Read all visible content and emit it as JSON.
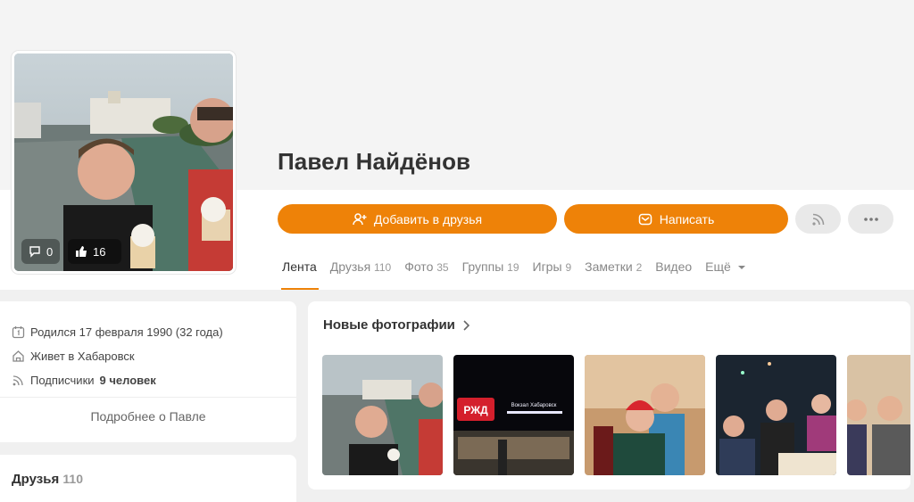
{
  "profile": {
    "name": "Павел Найдёнов",
    "comments_count": "0",
    "likes_count": "16"
  },
  "actions": {
    "add_friend_label": "Добавить в друзья",
    "write_label": "Написать",
    "subscribe_icon": "rss-icon",
    "more_icon": "ellipsis-icon"
  },
  "tabs": [
    {
      "label": "Лента",
      "count": ""
    },
    {
      "label": "Друзья",
      "count": "110"
    },
    {
      "label": "Фото",
      "count": "35"
    },
    {
      "label": "Группы",
      "count": "19"
    },
    {
      "label": "Игры",
      "count": "9"
    },
    {
      "label": "Заметки",
      "count": "2"
    },
    {
      "label": "Видео",
      "count": ""
    },
    {
      "label": "Ещё",
      "count": ""
    }
  ],
  "info": {
    "birth": "Родился 17 февраля 1990 (32 года)",
    "city": "Живет в Хабаровск",
    "subscribers_prefix": "Подписчики",
    "subscribers_value": "9 человек",
    "more_link": "Подробнее о Павле"
  },
  "friends": {
    "title": "Друзья",
    "count": "110"
  },
  "photos": {
    "title": "Новые фотографии",
    "thumb_sign": "РЖД",
    "thumb_sign2": "Вокзал Хабаровск"
  },
  "colors": {
    "accent": "#ee8208",
    "page_bg": "#f0f0f0"
  }
}
